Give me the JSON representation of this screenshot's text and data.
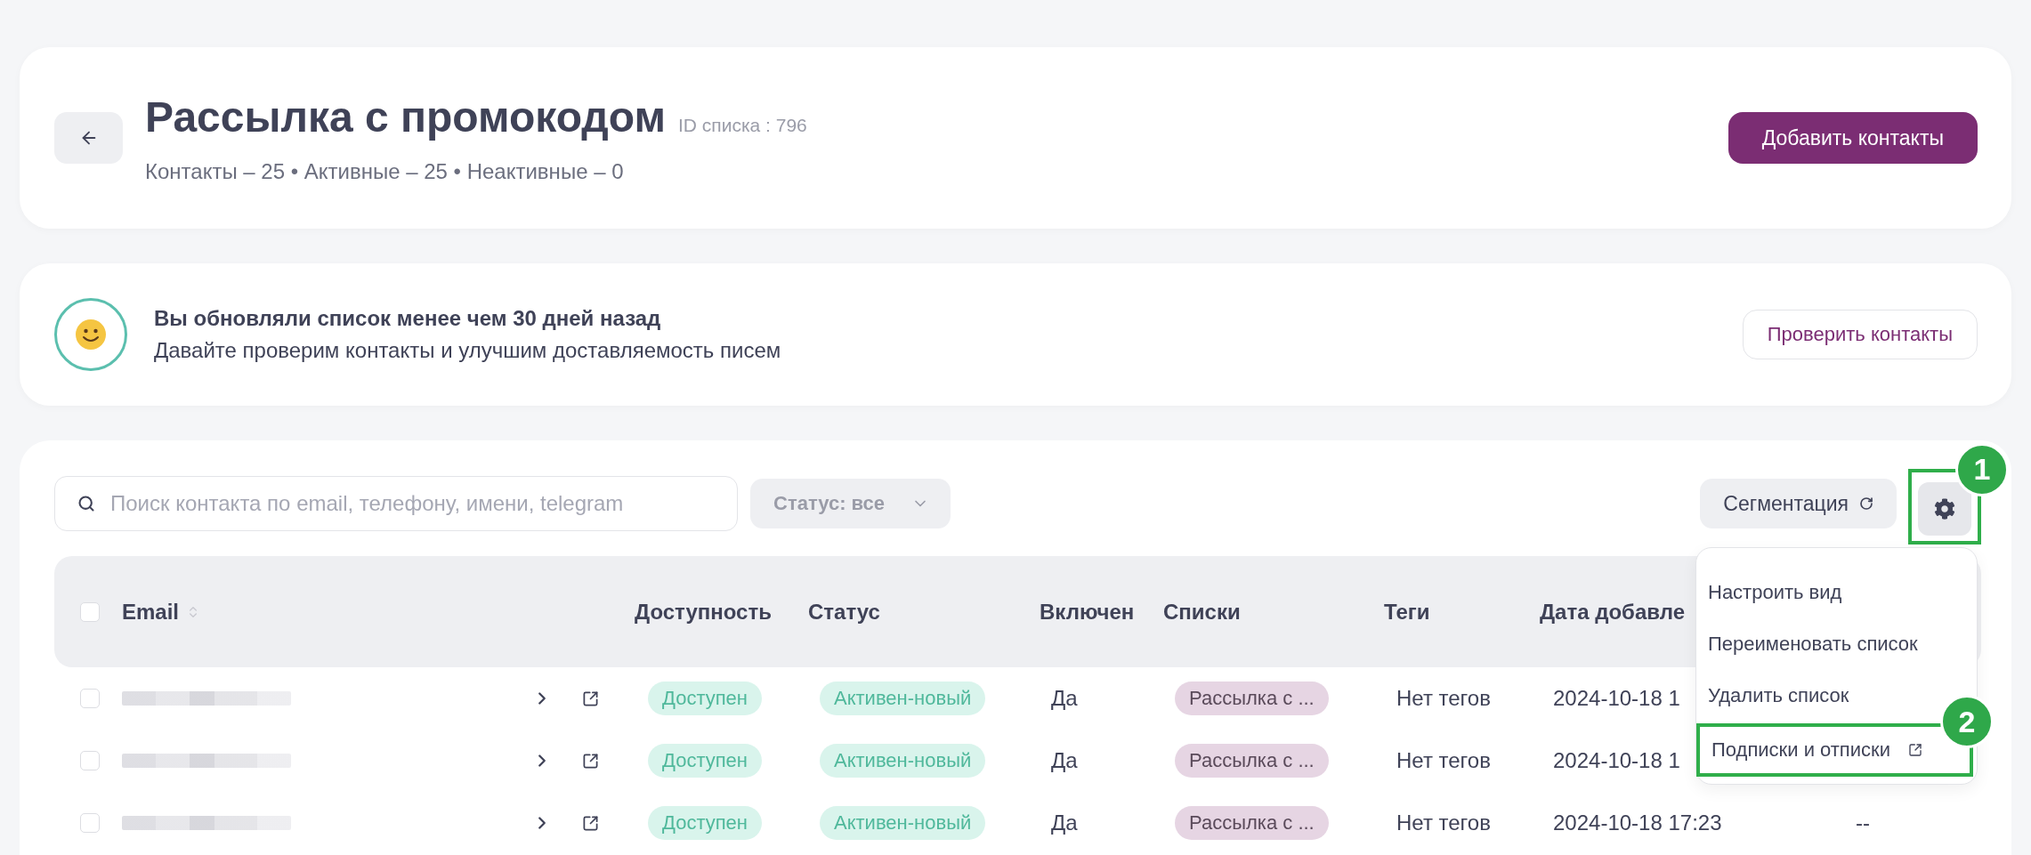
{
  "header": {
    "title": "Рассылка с промокодом",
    "list_id": "ID списка : 796",
    "stats": "Контакты – 25 • Активные – 25 • Неактивные – 0",
    "add_button": "Добавить контакты"
  },
  "notice": {
    "title": "Вы обновляли список менее чем 30 дней назад",
    "text": "Давайте проверим контакты и улучшим доставляемость писем",
    "button": "Проверить контакты"
  },
  "toolbar": {
    "search": {
      "placeholder": "Поиск контакта по email, телефону, имени, telegram"
    },
    "status_filter": "Статус: все",
    "segmentation_button": "Сегментация",
    "settings_button": {
      "annotation": "1"
    }
  },
  "table": {
    "all_checked": false,
    "columns": [
      {
        "label": "Email"
      },
      {
        "label": "Доступность"
      },
      {
        "label": "Статус"
      },
      {
        "label": "Включен"
      },
      {
        "label": "Списки"
      },
      {
        "label": "Теги"
      },
      {
        "label": "Дата добавле"
      }
    ],
    "rows": [
      {
        "checked": false,
        "availability": "Доступен",
        "status": "Активен-новый",
        "enabled": "Да",
        "list": "Рассылка с ...",
        "tags": "Нет тегов",
        "date": "2024-10-18 1"
      },
      {
        "checked": false,
        "availability": "Доступен",
        "status": "Активен-новый",
        "enabled": "Да",
        "list": "Рассылка с ...",
        "tags": "Нет тегов",
        "date": "2024-10-18 1"
      },
      {
        "checked": false,
        "availability": "Доступен",
        "status": "Активен-новый",
        "enabled": "Да",
        "list": "Рассылка с ...",
        "tags": "Нет тегов",
        "date": "2024-10-18 17:23",
        "column_9": "--"
      }
    ]
  },
  "settings_menu": {
    "items": [
      {
        "label": "Настроить вид",
        "external": false
      },
      {
        "label": "Переименовать список",
        "external": false
      },
      {
        "label": "Удалить список",
        "external": false
      },
      {
        "label": "Подписки и отписки",
        "external": true,
        "annotation": "2"
      }
    ]
  }
}
